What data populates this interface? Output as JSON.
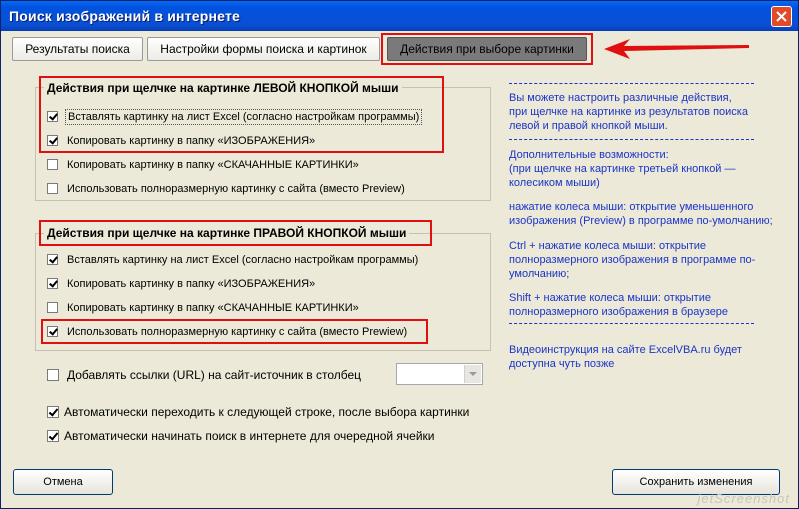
{
  "window": {
    "title": "Поиск изображений в интернете"
  },
  "tabs": [
    {
      "label": "Результаты поиска"
    },
    {
      "label": "Настройки формы поиска и картинок"
    },
    {
      "label": "Действия при выборе картинки"
    }
  ],
  "left_group": {
    "title": "Действия при щелчке на картинке ЛЕВОЙ КНОПКОЙ мыши",
    "options": [
      {
        "label": "Вставлять картинку на лист Excel (согласно настройкам программы)",
        "checked": true
      },
      {
        "label": "Копировать картинку в папку «ИЗОБРАЖЕНИЯ»",
        "checked": true
      },
      {
        "label": "Копировать картинку в папку «СКАЧАННЫЕ КАРТИНКИ»",
        "checked": false
      },
      {
        "label": "Использовать полноразмерную картинку с сайта (вместо Preview)",
        "checked": false
      }
    ]
  },
  "right_group": {
    "title": "Действия при щелчке на картинке ПРАВОЙ КНОПКОЙ мыши",
    "options": [
      {
        "label": "Вставлять картинку на лист Excel (согласно настройкам программы)",
        "checked": true
      },
      {
        "label": "Копировать картинку в папку «ИЗОБРАЖЕНИЯ»",
        "checked": true
      },
      {
        "label": "Копировать картинку в папку «СКАЧАННЫЕ КАРТИНКИ»",
        "checked": false
      },
      {
        "label": "Использовать полноразмерную картинку с сайта (вместо Prewiew)",
        "checked": true
      }
    ]
  },
  "extra_options": [
    {
      "label": "Добавлять ссылки (URL) на сайт-источник в столбец",
      "checked": false
    },
    {
      "label": "Автоматически переходить к следующей строке, после выбора картинки",
      "checked": true
    },
    {
      "label": "Автоматически начинать поиск в интернете для очередной ячейки",
      "checked": true
    }
  ],
  "column_select": {
    "value": ""
  },
  "info": {
    "p1": [
      "Вы можете настроить различные действия,",
      "при щелчке на картинке из результатов поиска",
      "левой и правой кнопкой мыши."
    ],
    "p2": [
      "Дополнительные возможности:",
      "(при щелчке на картинке третьей кнопкой —",
      "колесиком мыши)"
    ],
    "p3": [
      "нажатие колеса мыши: открытие уменьшенного",
      "изображения (Preview) в программе по-умолчанию;"
    ],
    "p4": [
      "Ctrl + нажатие колеса мыши: открытие",
      "полноразмерного изображения в программе по-",
      "умолчанию;"
    ],
    "p5": [
      "Shift + нажатие колеса мыши: открытие",
      "полноразмерного изображения в браузере"
    ],
    "p6": [
      "Видеоинструкция на сайте ExcelVBA.ru будет",
      "доступна чуть позже"
    ]
  },
  "buttons": {
    "cancel": "Отмена",
    "save": "Сохранить изменения"
  },
  "watermark": "jetScreenshot",
  "colors": {
    "highlight": "#e01010",
    "info_text": "#1a34c8",
    "titlebar": "#0053e0"
  }
}
